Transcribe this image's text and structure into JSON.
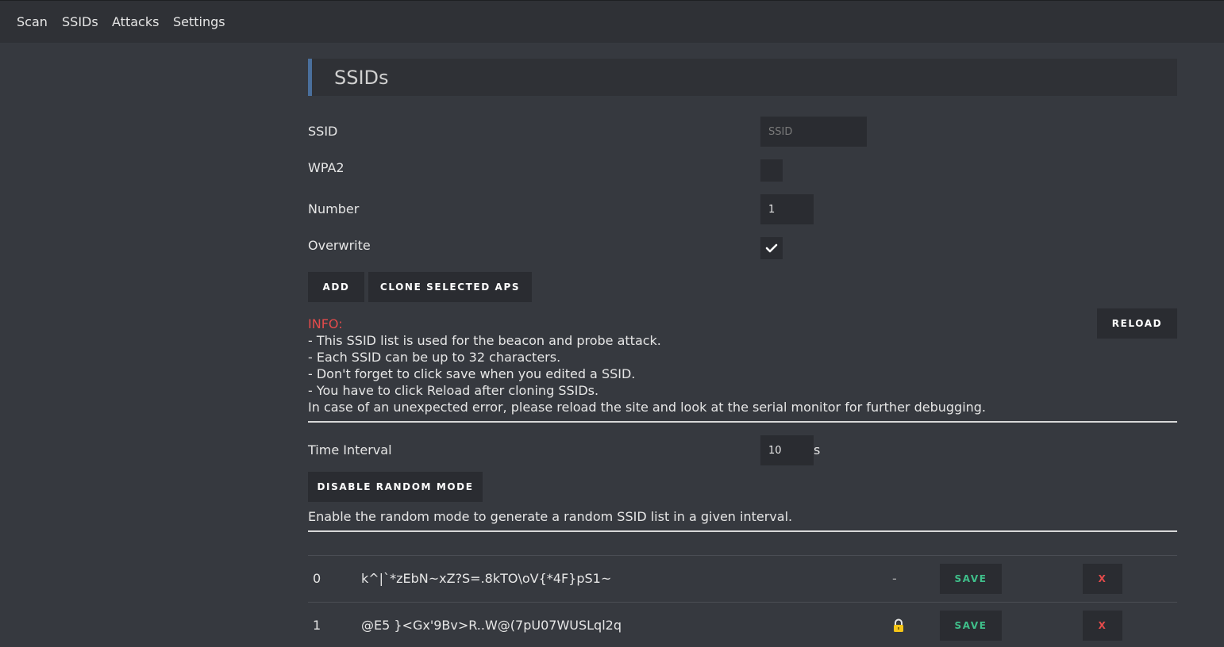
{
  "nav": {
    "items": [
      "Scan",
      "SSIDs",
      "Attacks",
      "Settings"
    ]
  },
  "page": {
    "title": "SSIDs"
  },
  "form": {
    "ssid_label": "SSID",
    "ssid_placeholder": "SSID",
    "ssid_value": "",
    "wpa2_label": "WPA2",
    "wpa2_checked": false,
    "number_label": "Number",
    "number_value": "1",
    "overwrite_label": "Overwrite",
    "overwrite_checked": true,
    "add_label": "ADD",
    "clone_label": "CLONE SELECTED APS",
    "reload_label": "RELOAD"
  },
  "info": {
    "title": "INFO:",
    "lines": [
      "- This SSID list is used for the beacon and probe attack.",
      "- Each SSID can be up to 32 characters.",
      "- Don't forget to click save when you edited a SSID.",
      "- You have to click Reload after cloning SSIDs.",
      "In case of an unexpected error, please reload the site and look at the serial monitor for further debugging."
    ]
  },
  "random": {
    "interval_label": "Time Interval",
    "interval_value": "10",
    "interval_unit": "s",
    "toggle_label": "DISABLE RANDOM MODE",
    "description": "Enable the random mode to generate a random SSID list in a given interval."
  },
  "ssid_list": {
    "rows": [
      {
        "index": "0",
        "name": "k^|`*zEbN~xZ?S=.8kTO\\oV{*4F}pS1~",
        "security": "-",
        "save_label": "SAVE",
        "delete_label": "X"
      },
      {
        "index": "1",
        "name": "@E5 }<Gx'9Bv>R..W@(7pU07WUSLql2q",
        "security": "lock",
        "save_label": "SAVE",
        "delete_label": "X"
      }
    ]
  },
  "colors": {
    "accent": "#4a6f9c",
    "info": "#e54b4b",
    "save": "#3fbf8a",
    "delete": "#e54b4b",
    "lock": "#f5c518"
  }
}
